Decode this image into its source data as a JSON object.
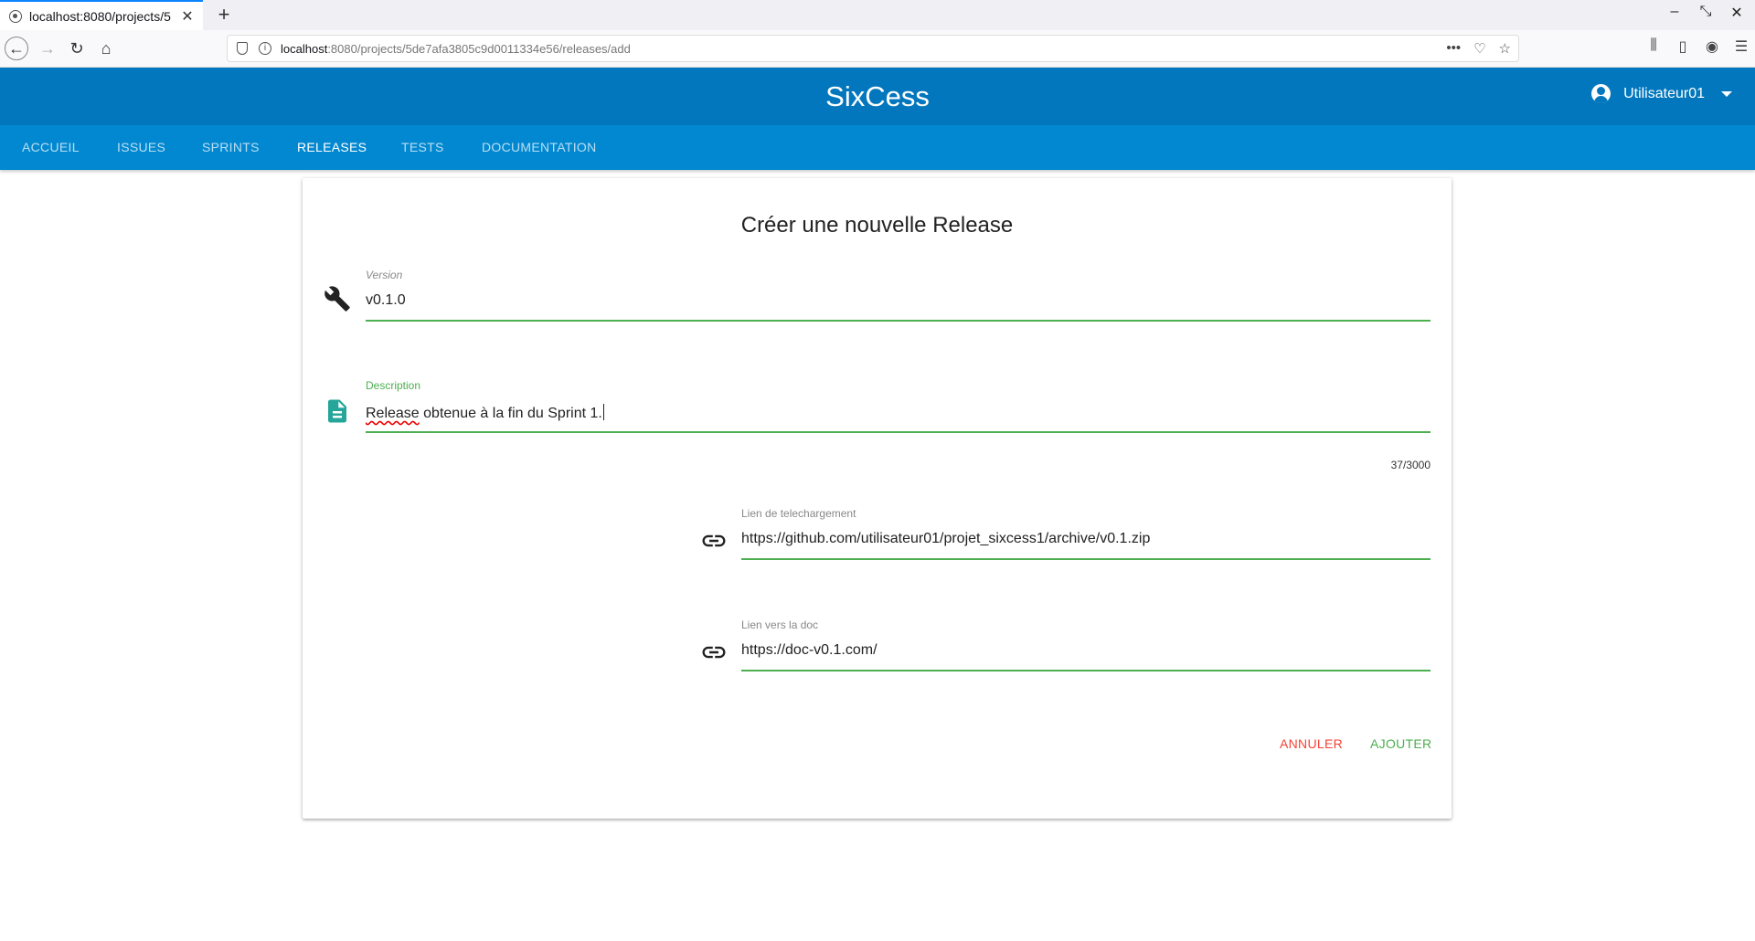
{
  "browser": {
    "tab_title": "localhost:8080/projects/5",
    "url_host": "localhost",
    "url_path": ":8080/projects/5de7afa3805c9d0011334e56/releases/add"
  },
  "app": {
    "title": "SixCess",
    "username": "Utilisateur01",
    "brand_color": "#0277bd",
    "nav_color": "#0288d1"
  },
  "nav": {
    "tabs": [
      {
        "label": "ACCUEIL"
      },
      {
        "label": "ISSUES"
      },
      {
        "label": "SPRINTS"
      },
      {
        "label": "RELEASES"
      },
      {
        "label": "TESTS"
      },
      {
        "label": "DOCUMENTATION"
      }
    ],
    "active": "RELEASES"
  },
  "form": {
    "title": "Créer une nouvelle Release",
    "version": {
      "label": "Version",
      "value": "v0.1.0",
      "icon": "wrench-icon"
    },
    "description": {
      "label": "Description",
      "value_first_word": "Release",
      "value_rest": " obtenue à la fin du Sprint 1.",
      "counter": "37/3000",
      "icon": "document-icon"
    },
    "download_link": {
      "label": "Lien de telechargement",
      "value": "https://github.com/utilisateur01/projet_sixcess1/archive/v0.1.zip",
      "icon": "link-icon"
    },
    "doc_link": {
      "label": "Lien vers la doc",
      "value": "https://doc-v0.1.com/",
      "icon": "link-icon"
    },
    "cancel_label": "ANNULER",
    "submit_label": "AJOUTER"
  }
}
